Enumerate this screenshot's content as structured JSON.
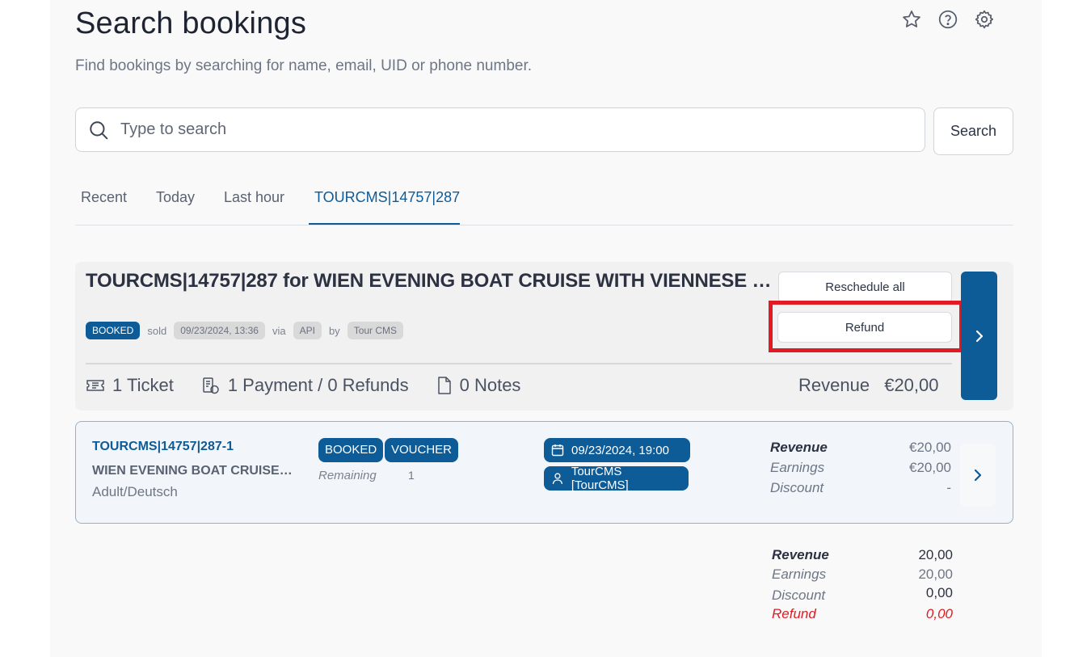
{
  "header": {
    "title": "Search bookings",
    "subtitle": "Find bookings by searching for name, email, UID or phone number."
  },
  "icons": {
    "favorite": "star-icon",
    "help": "help-icon",
    "settings": "gear-icon"
  },
  "search": {
    "placeholder": "Type to search",
    "value": "",
    "button_label": "Search"
  },
  "tabs": [
    {
      "label": "Recent",
      "active": false
    },
    {
      "label": "Today",
      "active": false
    },
    {
      "label": "Last hour",
      "active": false
    },
    {
      "label": "TOURCMS|14757|287",
      "active": true
    }
  ],
  "booking": {
    "title": "TOURCMS|14757|287 for WIEN EVENING BOAT CRUISE WITH VIENNESE MUSIC",
    "status": "BOOKED",
    "sold_label": "sold",
    "sold_date": "09/23/2024, 13:36",
    "via_label": "via",
    "via": "API",
    "by_label": "by",
    "by": "Tour CMS",
    "reschedule_label": "Reschedule all",
    "refund_label": "Refund",
    "stats": {
      "tickets": "1 Ticket",
      "payments": "1 Payment / 0 Refunds",
      "notes": "0 Notes"
    },
    "revenue_label": "Revenue",
    "revenue_value": "€20,00"
  },
  "ticket": {
    "id": "TOURCMS|14757|287-1",
    "name": "WIEN EVENING BOAT CRUISE WITH VIENNESE MUSIC",
    "type": "Adult/Deutsch",
    "badges": [
      "BOOKED",
      "VOUCHER"
    ],
    "remaining_label": "Remaining",
    "remaining_value": "1",
    "date": "09/23/2024, 19:00",
    "provider": "TourCMS [TourCMS]",
    "revenue_label": "Revenue",
    "revenue_value": "€20,00",
    "earnings_label": "Earnings",
    "earnings_value": "€20,00",
    "discount_label": "Discount",
    "discount_value": "-"
  },
  "totals": {
    "revenue_label": "Revenue",
    "revenue_value": "20,00",
    "earnings_label": "Earnings",
    "earnings_value": "20,00",
    "discount_label": "Discount",
    "discount_value": "0,00",
    "refund_label": "Refund",
    "refund_value": "0,00"
  },
  "colors": {
    "brand": "#0d5b97",
    "highlight": "#e01b24",
    "refund": "#e01b24"
  }
}
